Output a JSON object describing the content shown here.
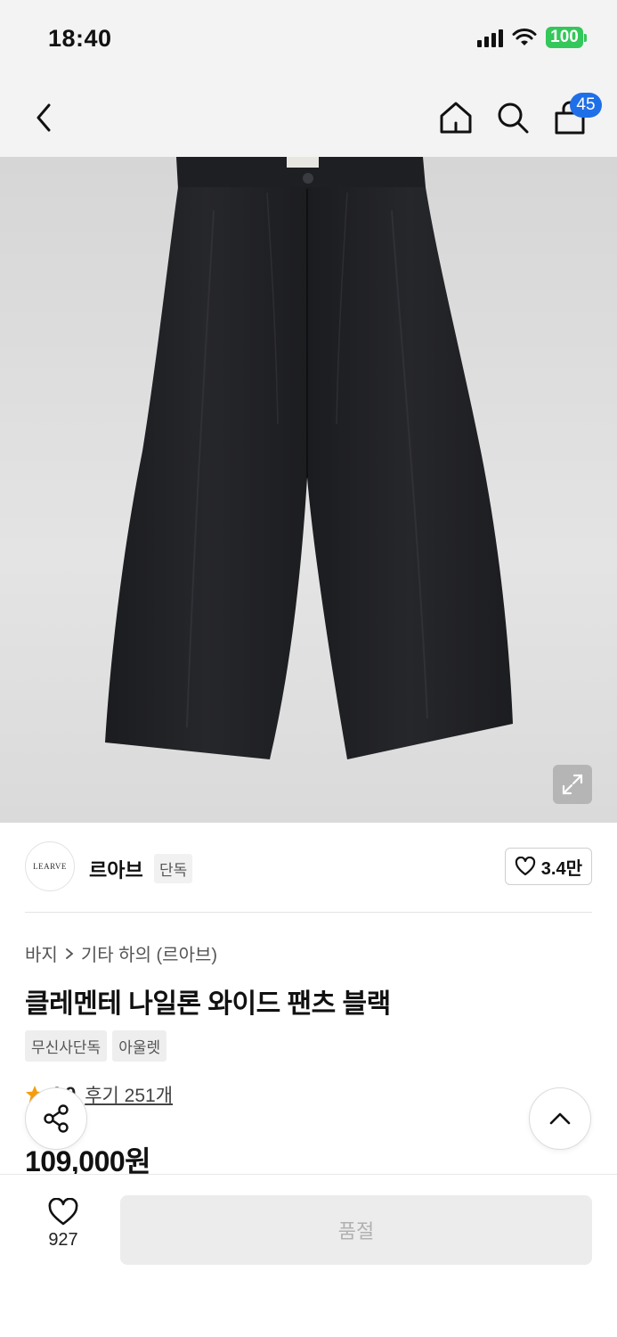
{
  "status_bar": {
    "time": "18:40",
    "battery": "100",
    "icons": [
      "signal-icon",
      "wifi-icon",
      "battery-icon"
    ]
  },
  "nav": {
    "back_icon": "chevron-left-icon",
    "home_icon": "home-icon",
    "search_icon": "search-icon",
    "cart_icon": "shopping-bag-icon",
    "cart_count": "45"
  },
  "product_image": {
    "expand_icon": "expand-icon"
  },
  "brand": {
    "logo_text": "LEARVE",
    "name": "르아브",
    "tag": "단독",
    "likes": "3.4만"
  },
  "product": {
    "breadcrumb": [
      "바지",
      "기타 하의 (르아브)"
    ],
    "title": "클레멘테 나일론 와이드 팬츠 블랙",
    "badges": [
      "무신사단독",
      "아울렛"
    ],
    "rating": "4.9",
    "reviews": "후기 251개",
    "price": "109,000원"
  },
  "bottom_bar": {
    "wish_count": "927",
    "buy_label": "품절"
  },
  "colors": {
    "accent_badge": "#1f6fe8",
    "battery": "#34c759",
    "star": "#f59e0b",
    "soldout_bg": "#ececec"
  }
}
